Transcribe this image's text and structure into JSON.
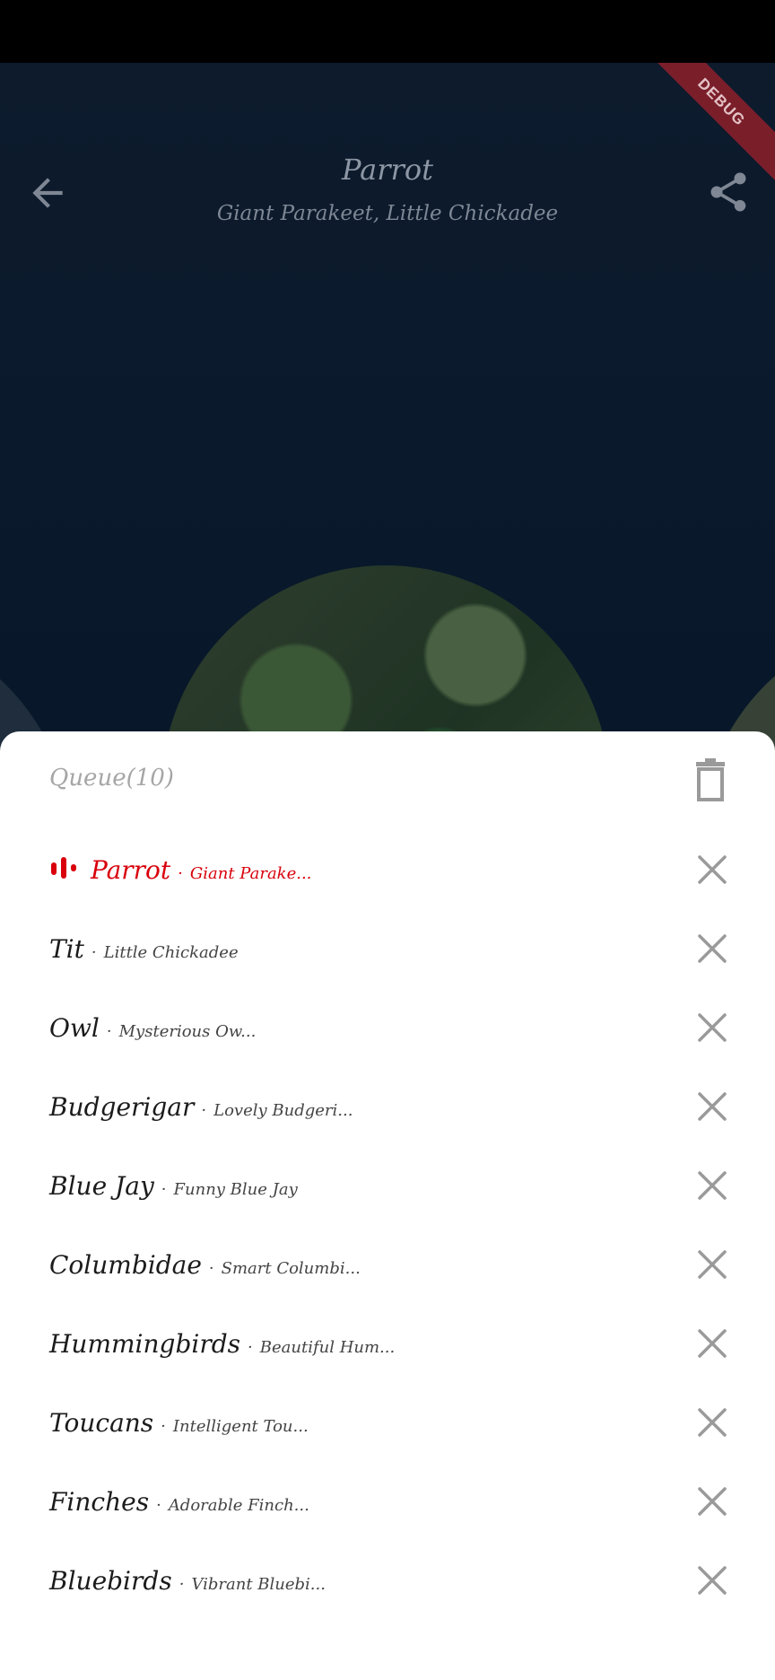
{
  "player": {
    "title": "Parrot",
    "subtitle": "Giant Parakeet, Little Chickadee",
    "debug_banner": "DEBUG",
    "icons": {
      "back": "arrow-left-icon",
      "share": "share-icon"
    }
  },
  "queue": {
    "title": "Queue(10)",
    "clear_icon": "trash-icon",
    "accent_color": "#d9000c",
    "items": [
      {
        "title": "Parrot",
        "sep": "·",
        "subtitle": "Giant Parake...",
        "active": true
      },
      {
        "title": "Tit",
        "sep": "·",
        "subtitle": "Little Chickadee",
        "active": false
      },
      {
        "title": "Owl",
        "sep": "·",
        "subtitle": "Mysterious Ow...",
        "active": false
      },
      {
        "title": "Budgerigar",
        "sep": "·",
        "subtitle": "Lovely Budgeri...",
        "active": false
      },
      {
        "title": "Blue Jay",
        "sep": "·",
        "subtitle": "Funny Blue Jay",
        "active": false
      },
      {
        "title": "Columbidae",
        "sep": "·",
        "subtitle": "Smart Columbi...",
        "active": false
      },
      {
        "title": "Hummingbirds",
        "sep": "·",
        "subtitle": "Beautiful Hum...",
        "active": false
      },
      {
        "title": "Toucans",
        "sep": "·",
        "subtitle": "Intelligent Tou...",
        "active": false
      },
      {
        "title": "Finches",
        "sep": "·",
        "subtitle": "Adorable Finch...",
        "active": false
      },
      {
        "title": "Bluebirds",
        "sep": "·",
        "subtitle": "Vibrant Bluebi...",
        "active": false
      }
    ]
  }
}
